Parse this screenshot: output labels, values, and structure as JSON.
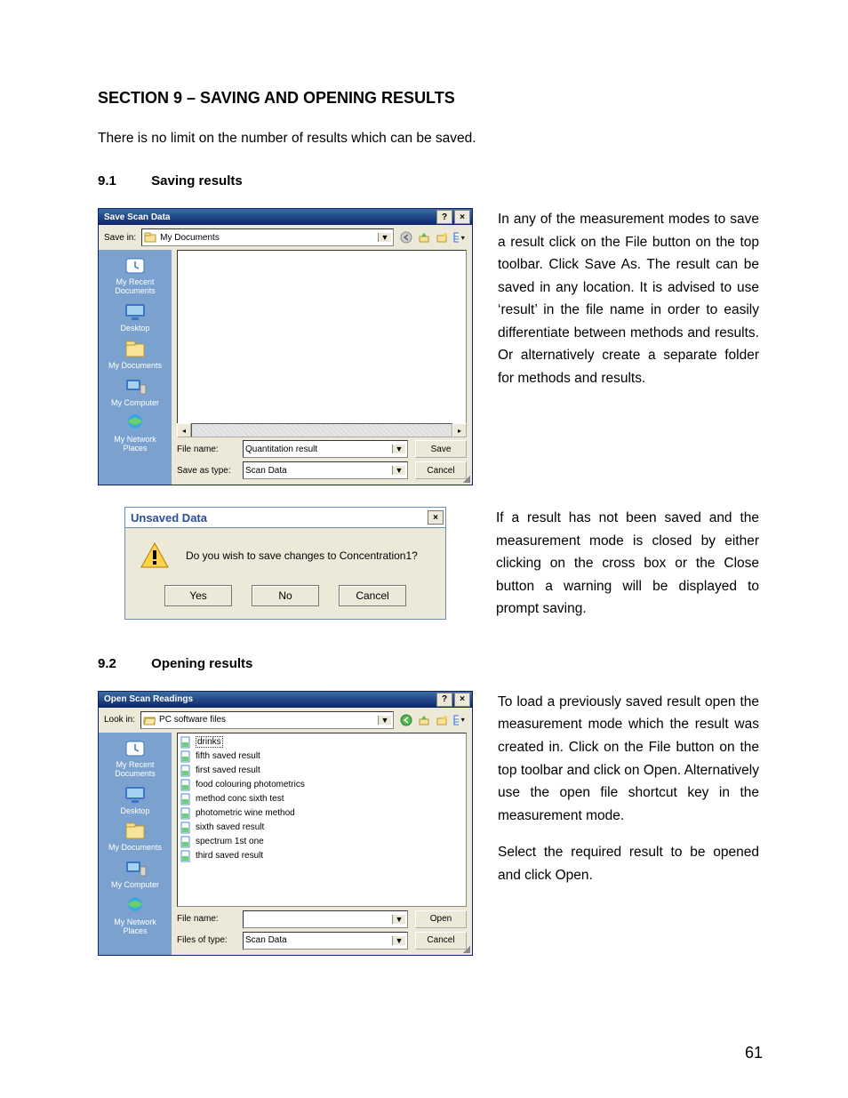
{
  "section_title": "SECTION 9 – SAVING AND OPENING RESULTS",
  "intro_text": "There is no limit on the number of results which can be saved.",
  "sub1": {
    "num": "9.1",
    "title": "Saving results"
  },
  "sub2": {
    "num": "9.2",
    "title": "Opening results"
  },
  "para1": "In any of the measurement modes to save a result click on the File button on the top toolbar. Click Save As. The result can be saved in any location. It is advised to use ‘result’ in the file name in order to easily differentiate between methods and results. Or alternatively create a separate folder for methods and results.",
  "para2": "If a result has not been saved and the measurement mode is closed by either clicking on the cross box or the Close button a warning will be displayed to prompt saving.",
  "para3": "To load a previously saved result open the measurement mode which the result was created in. Click on the File button on the top toolbar and click on Open. Alternatively use the open file shortcut key in the measurement mode.",
  "para4": "Select the required result to be opened and click Open.",
  "page_number": "61",
  "save_dialog": {
    "title": "Save Scan Data",
    "help_btn": "?",
    "close_btn": "×",
    "save_in_label": "Save in:",
    "save_in_value": "My Documents",
    "places": [
      "My Recent Documents",
      "Desktop",
      "My Documents",
      "My Computer",
      "My Network Places"
    ],
    "file_name_label": "File name:",
    "file_name_value": "Quantitation result",
    "save_as_type_label": "Save as type:",
    "save_as_type_value": "Scan Data",
    "save_btn": "Save",
    "cancel_btn": "Cancel"
  },
  "msgbox": {
    "title": "Unsaved Data",
    "close_btn": "×",
    "message": "Do you wish to save changes to Concentration1?",
    "yes": "Yes",
    "no": "No",
    "cancel": "Cancel"
  },
  "open_dialog": {
    "title": "Open Scan Readings",
    "help_btn": "?",
    "close_btn": "×",
    "look_in_label": "Look in:",
    "look_in_value": "PC software files",
    "places": [
      "My Recent Documents",
      "Desktop",
      "My Documents",
      "My Computer",
      "My Network Places"
    ],
    "files": [
      "drinks",
      "fifth saved result",
      "first saved result",
      "food colouring photometrics",
      "method conc sixth test",
      "photometric wine method",
      "sixth saved result",
      "spectrum 1st one",
      "third saved result"
    ],
    "file_name_label": "File name:",
    "file_name_value": "",
    "files_of_type_label": "Files of type:",
    "files_of_type_value": "Scan Data",
    "open_btn": "Open",
    "cancel_btn": "Cancel"
  }
}
